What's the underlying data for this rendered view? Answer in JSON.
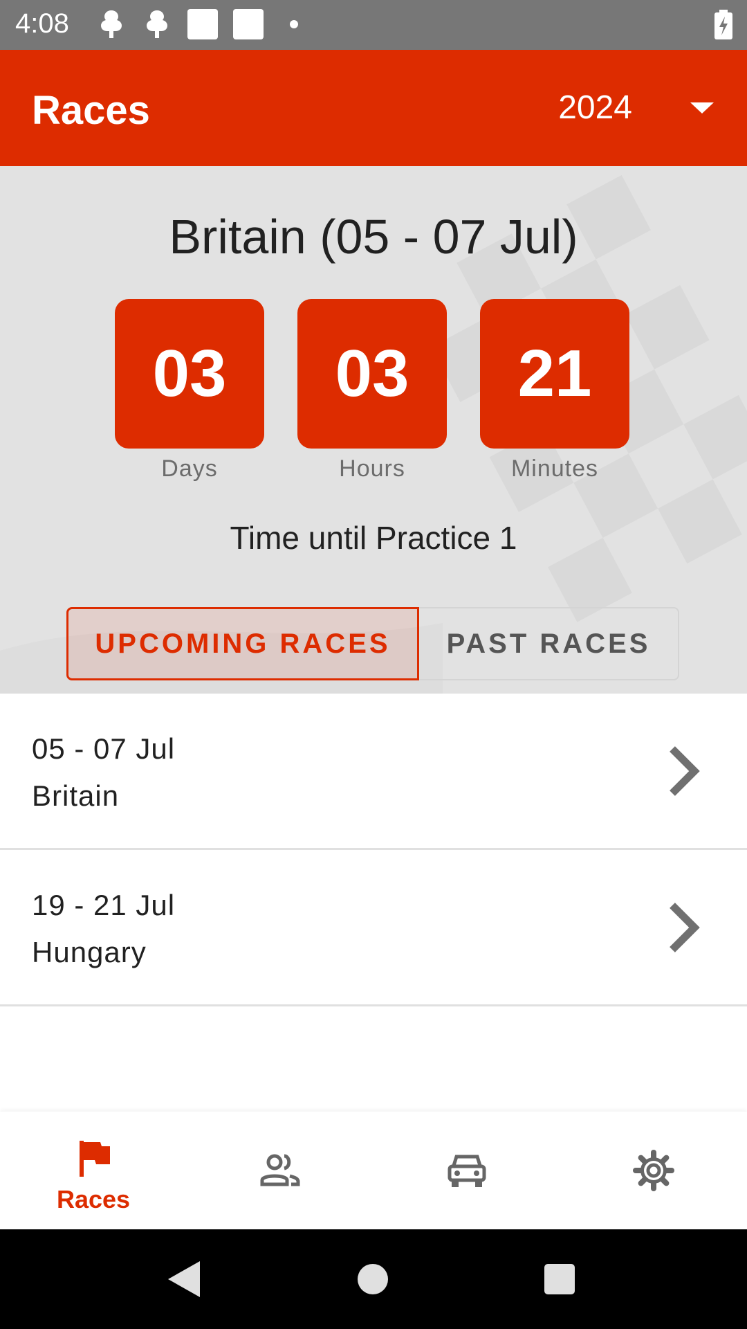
{
  "status_bar": {
    "time": "4:08",
    "icons": [
      "tree-icon",
      "tree-icon",
      "square-icon",
      "square-icon",
      "dot-icon"
    ],
    "battery_icon": "battery-charging-icon"
  },
  "app_bar": {
    "title": "Races",
    "year": "2024",
    "dropdown_icon": "arrow-drop-down-icon"
  },
  "next_race": {
    "heading": "Britain (05 - 07 Jul)",
    "countdown": [
      {
        "value": "03",
        "label": "Days"
      },
      {
        "value": "03",
        "label": "Hours"
      },
      {
        "value": "21",
        "label": "Minutes"
      }
    ],
    "until_text": "Time until Practice 1"
  },
  "tabs": {
    "upcoming": "UPCOMING RACES",
    "past": "PAST RACES",
    "selected": "upcoming"
  },
  "races": [
    {
      "date": "05 - 07 Jul",
      "name": "Britain"
    },
    {
      "date": "19 - 21 Jul",
      "name": "Hungary"
    }
  ],
  "bottom_nav": {
    "items": [
      {
        "icon": "flag-icon",
        "label": "Races",
        "active": true
      },
      {
        "icon": "people-icon",
        "label": "",
        "active": false
      },
      {
        "icon": "car-icon",
        "label": "",
        "active": false
      },
      {
        "icon": "settings-icon",
        "label": "",
        "active": false
      }
    ]
  },
  "colors": {
    "accent": "#dd2c00",
    "status_bar": "#777777",
    "hero_background": "#e2e2e2",
    "inactive_icon": "#666666"
  }
}
